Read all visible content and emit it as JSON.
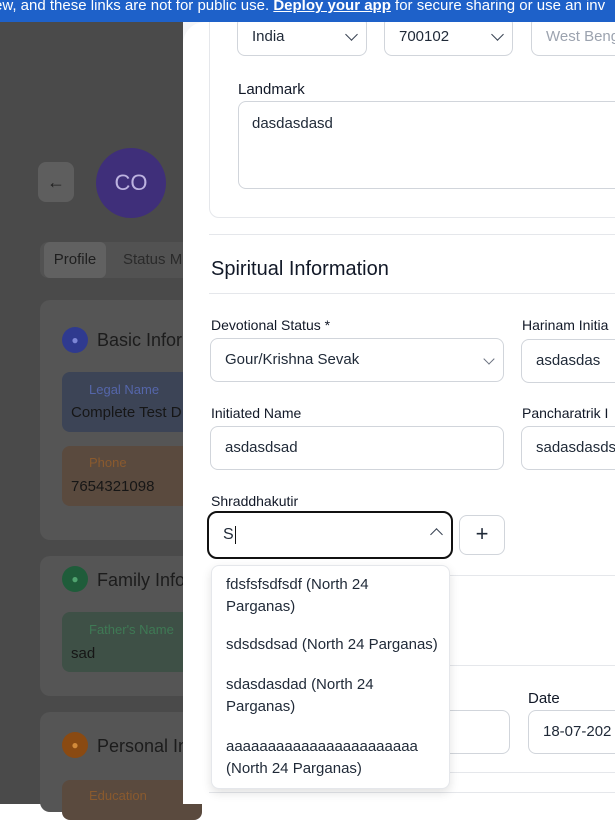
{
  "banner": {
    "text_before": "ew, and these links are not for public use. ",
    "link": "Deploy your app",
    "text_after": " for secure sharing or use an inv"
  },
  "background": {
    "avatar_initials": "CO",
    "tabs": [
      "Profile",
      "Status M"
    ],
    "sections": {
      "basic": {
        "title": "Basic Inform",
        "legal_name_label": "Legal Name",
        "legal_name_value": "Complete Test D",
        "phone_label": "Phone",
        "phone_value": "7654321098"
      },
      "family": {
        "title": "Family Infor",
        "father_label": "Father's Name",
        "father_value": "sad"
      },
      "personal": {
        "title": "Personal In",
        "education_label": "Education"
      }
    },
    "colors": {
      "basic_icon": "#2f3a8f",
      "family_icon": "#1f5c3a",
      "personal_icon": "#8a4a12"
    }
  },
  "address": {
    "country": "India",
    "pincode": "700102",
    "state_placeholder": "West Beng",
    "landmark_label": "Landmark",
    "landmark_value": "dasdasdasd"
  },
  "spiritual": {
    "heading": "Spiritual Information",
    "devotional_status_label": "Devotional Status *",
    "devotional_status_value": "Gour/Krishna Sevak",
    "harinam_label": "Harinam Initia",
    "harinam_value": "asdasdas",
    "initiated_name_label": "Initiated Name",
    "initiated_name_value": "asdasdsad",
    "pancharatrik_label": "Pancharatrik I",
    "pancharatrik_value": "sadasdasdsa",
    "shraddhakutir_label": "Shraddhakutir",
    "shraddhakutir_input": "S",
    "add_label": "+",
    "options": [
      "fdsfsfsdfsdf (North 24 Parganas)",
      "sdsdsdsad (North 24 Parganas)",
      "sdasdasdad (North 24 Parganas)",
      "aaaaaaaaaaaaaaaaaaaaaaa (North 24 Parganas)"
    ]
  },
  "date": {
    "label": "Date",
    "value": "18-07-202"
  }
}
